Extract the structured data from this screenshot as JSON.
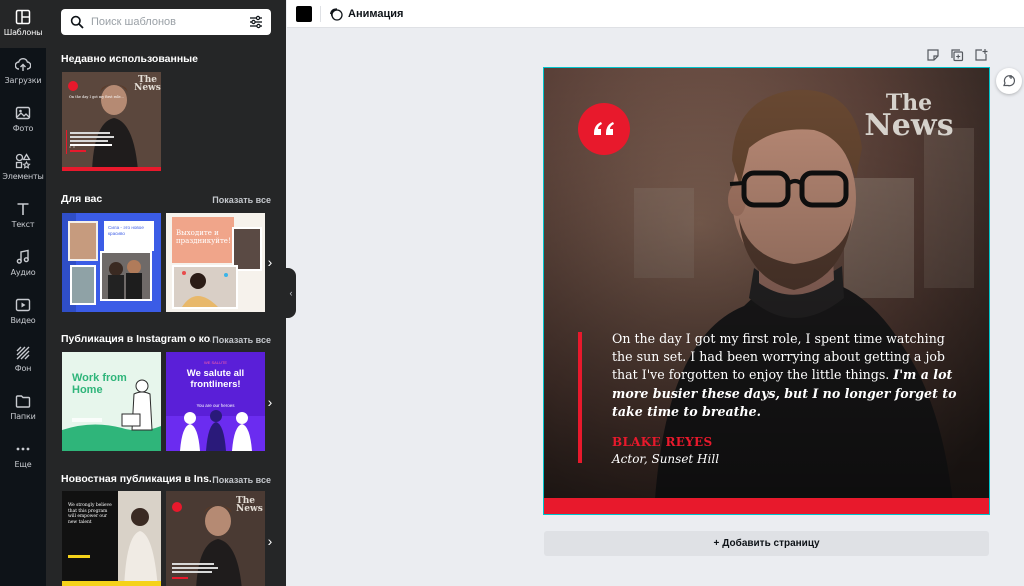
{
  "sidebar": {
    "items": [
      {
        "label": "Шаблоны",
        "icon": "templates-icon"
      },
      {
        "label": "Загрузки",
        "icon": "upload-icon"
      },
      {
        "label": "Фото",
        "icon": "photo-icon"
      },
      {
        "label": "Элементы",
        "icon": "elements-icon"
      },
      {
        "label": "Текст",
        "icon": "text-icon"
      },
      {
        "label": "Аудио",
        "icon": "audio-icon"
      },
      {
        "label": "Видео",
        "icon": "video-icon"
      },
      {
        "label": "Фон",
        "icon": "background-icon"
      },
      {
        "label": "Папки",
        "icon": "folder-icon"
      },
      {
        "label": "Еще",
        "icon": "more-icon"
      }
    ]
  },
  "templates_panel": {
    "search_placeholder": "Поиск шаблонов",
    "sections": [
      {
        "title": "Недавно использованные"
      },
      {
        "title": "Для вас",
        "link": "Показать все"
      },
      {
        "title": "Публикация в Instagram о ко...",
        "link": "Показать все"
      },
      {
        "title": "Новостная публикация в Ins...",
        "link": "Показать все"
      }
    ],
    "thumbs": {
      "recent_quote": "The News",
      "for_you_1": "Сила - это новое красиво",
      "for_you_2": "Выходите и праздникуйте!",
      "work_from_home": "Work from Home",
      "frontliners_top": "WE SALUTE",
      "frontliners": "We salute all frontliners!",
      "frontliners_sub": "You are our heroes",
      "news_1": "We strongly believe that this program will empower our new talent"
    }
  },
  "toolbar": {
    "color": "#000000",
    "animation_label": "Анимация"
  },
  "design": {
    "logo_line1": "The",
    "logo_line2": "News",
    "quote_regular": "On the day I got my first role, I spent time watching the sun set. I had been worrying about getting a job that I've forgotten to enjoy the little things. ",
    "quote_emphasis": "I'm a lot more busier these days, but I no longer forget to take time to breathe.",
    "author": "BLAKE REYES",
    "role": "Actor, Sunset Hill",
    "accent": "#e8192c"
  },
  "add_page_label": "Добавить страницу"
}
